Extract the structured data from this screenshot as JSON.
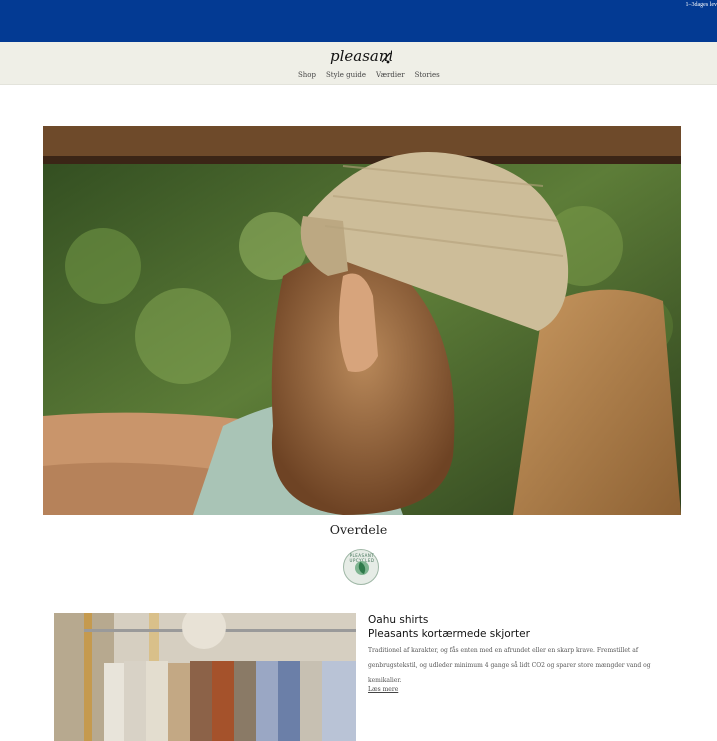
{
  "topbar": {
    "text": "1–3dages lev"
  },
  "header": {
    "logo_text": "pleasant",
    "nav": [
      "Shop",
      "Style guide",
      "Værdier",
      "Stories"
    ]
  },
  "hero": {
    "section_title": "Overdele"
  },
  "badge": {
    "text": "PLEASANT UPCYCLED"
  },
  "product": {
    "title_line1": "Oahu shirts",
    "title_line2": "Pleasants kortærmede skjorter",
    "description": "Traditionel af karakter, og fås enten med en afrundet eller en skarp krave. Fremstillet af genbrugstekstil, og udleder minimum 4 gange så lidt CO2 og sparer store mængder vand og kemikalier.",
    "read_more": "Læs mere"
  },
  "colors": {
    "topbar": "#033a93",
    "header": "#efefe7"
  }
}
